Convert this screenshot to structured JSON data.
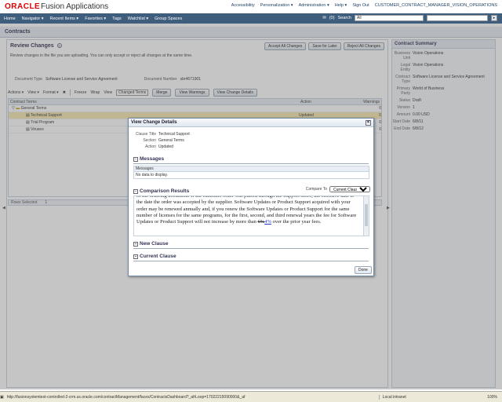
{
  "banner": {
    "oracle": "ORACLE",
    "app": "Fusion Applications",
    "links": [
      "Accessibility",
      "Personalization ▾",
      "Administration ▾",
      "Help ▾",
      "Sign Out",
      "CUSTOMER_CONTRACT_MANAGER_VISION_OPERATIONS"
    ]
  },
  "nav": {
    "items": [
      "Home",
      "Navigator ▾",
      "Recent Items ▾",
      "Favorites ▾",
      "Tags",
      "Watchlist ▾",
      "Group Spaces"
    ],
    "notif": "(0)",
    "search_label": "Search",
    "search_category": "All"
  },
  "region_title": "Contracts",
  "review": {
    "title": "Review Changes",
    "help": "?",
    "desc": "Review changes in the file you are uploading. You can only accept or reject all changes at the same time.",
    "buttons": [
      "Accept All Changes",
      "Save for Later",
      "Reject All Changes"
    ],
    "doc_type_label": "Document Type",
    "doc_type": "Software License and Service Agreement",
    "doc_number_label": "Document Number",
    "doc_number": "sbr4671901"
  },
  "toolbar": {
    "actions": "Actions ▾",
    "view": "View ▾",
    "format": "Format ▾",
    "freeze": "Freeze",
    "wrap": "Wrap",
    "view_label": "View",
    "view_value": "Changed Terms",
    "merge": "Merge",
    "view_warnings": "View Warnings",
    "view_change_details": "View Change Details"
  },
  "grid": {
    "col_terms": "Contract Terms",
    "col_action": "Action",
    "col_warnings": "Warnings",
    "rows": [
      {
        "label": "General Terms",
        "action": "",
        "warn": "0"
      },
      {
        "label": "Technical Support",
        "action": "Updated",
        "warn": "0"
      },
      {
        "label": "Trial Program",
        "action": "",
        "warn": "0"
      },
      {
        "label": "Viruses",
        "action": "",
        "warn": "0"
      }
    ],
    "rows_selected_label": "Rows Selected",
    "rows_selected": "1"
  },
  "summary": {
    "title": "Contract Summary",
    "rows": [
      {
        "label": "Business Unit",
        "value": "Vision Operations"
      },
      {
        "label": "Legal Entity",
        "value": "Vision Operations"
      },
      {
        "label": "Contract Type",
        "value": "Software License and Service Agreement"
      },
      {
        "label": "Primary Party",
        "value": "World of Business"
      },
      {
        "label": "Status",
        "value": "Draft"
      },
      {
        "label": "Version",
        "value": "1"
      },
      {
        "label": "Amount",
        "value": "0.00 USD"
      },
      {
        "label": "Start Date",
        "value": "6/8/11"
      },
      {
        "label": "End Date",
        "value": "6/8/12"
      }
    ]
  },
  "dialog": {
    "title": "View Change Details",
    "close": "✕",
    "clause_title_label": "Clause Title",
    "clause_title": "Technical Support",
    "section_label": "Section",
    "section": "General Terms",
    "action_label": "Action",
    "action": "Updated",
    "messages_title": "Messages",
    "messages_col": "Messages",
    "messages_empty": "No data to display.",
    "comparison_title": "Comparison Results",
    "compare_to_label": "Compare To",
    "compare_to_value": "Current Clause",
    "comparison_text_1": "of the ordering document. If the customer order was placed through the Support Store, the effective date is the date the order was accepted by the supplier. Software Updates or Product Support acquired with your order may be renewed annually and, if you renew the Software Updates or Product Support for the same number of licenses for the same programs, for the first, second, and third renewal years the fee for Software Updates or Product Support will not increase by more than ",
    "comparison_old": "6%",
    "comparison_new": "4%",
    "comparison_text_2": " over the prior year fees.",
    "new_clause_title": "New Clause",
    "current_clause_title": "Current Clause",
    "done": "Done"
  },
  "statusbar": {
    "url": "http://fusionsystemtest-controlled-2-crm.us.oracle.com/contractManagement/faces/ContractsDashboard?_afrLoop=17022215090000&_af",
    "zone": "Local intranet",
    "zoom": "100%"
  }
}
